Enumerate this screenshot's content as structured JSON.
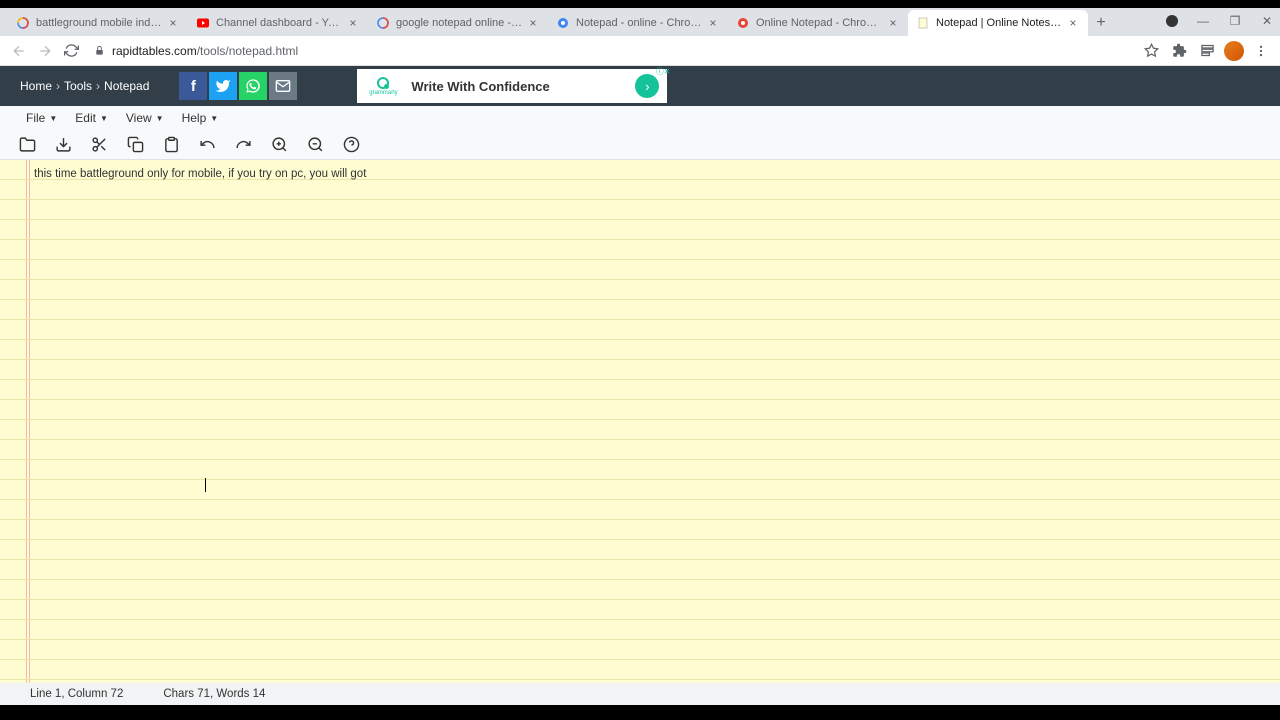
{
  "tabs": [
    {
      "title": "battleground mobile india emula",
      "favicon": "google"
    },
    {
      "title": "Channel dashboard - YouTube St",
      "favicon": "youtube"
    },
    {
      "title": "google notepad online - Google",
      "favicon": "google"
    },
    {
      "title": "Notepad - online - Chrome Web",
      "favicon": "chrome-store"
    },
    {
      "title": "Online Notepad - Chrome Web S",
      "favicon": "chrome-store"
    },
    {
      "title": "Notepad | Online Notes free, no",
      "favicon": "notepad"
    }
  ],
  "url": {
    "host": "rapidtables.com",
    "path": "/tools/notepad.html"
  },
  "breadcrumb": [
    "Home",
    "Tools",
    "Notepad"
  ],
  "ad": {
    "brand": "grammarly",
    "text": "Write With Confidence"
  },
  "menus": [
    "File",
    "Edit",
    "View",
    "Help"
  ],
  "tools": [
    "folder",
    "download",
    "cut",
    "copy",
    "paste",
    "undo",
    "redo",
    "zoom-in",
    "zoom-out",
    "help"
  ],
  "note_text": "this time battleground only for mobile, if you try on pc, you will got ",
  "status": {
    "line_col": "Line 1, Column 72",
    "chars_words": "Chars 71, Words 14"
  }
}
